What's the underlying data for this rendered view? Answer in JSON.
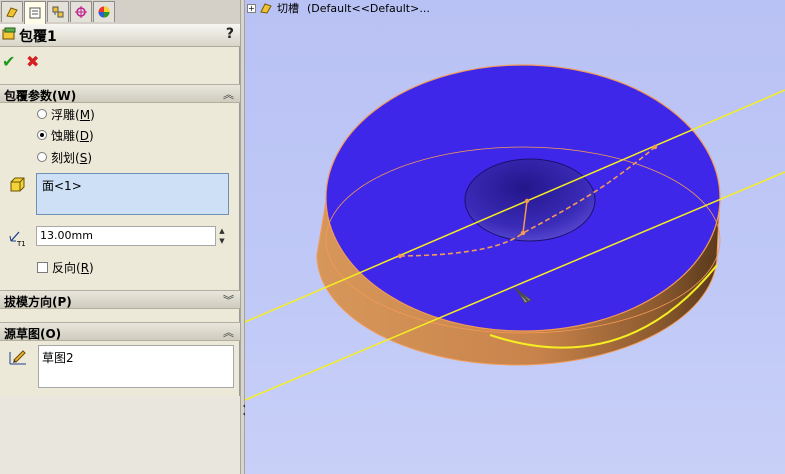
{
  "tabs": {
    "items": [
      {
        "icon": "feature-manager-icon"
      },
      {
        "icon": "property-manager-icon"
      },
      {
        "icon": "configuration-manager-icon"
      },
      {
        "icon": "dim-xpert-icon"
      },
      {
        "icon": "display-manager-icon"
      }
    ],
    "active": 1
  },
  "property_manager": {
    "title": "包覆1",
    "help": "?",
    "ok": "✔",
    "cancel": "✖"
  },
  "wrap_params": {
    "header": "包覆参数(W)",
    "options": [
      {
        "label": "浮雕",
        "mnemonic": "M",
        "selected": false
      },
      {
        "label": "蚀雕",
        "mnemonic": "D",
        "selected": true
      },
      {
        "label": "刻划",
        "mnemonic": "S",
        "selected": false
      }
    ],
    "face_selection": "面<1>",
    "depth_value": "13.00mm",
    "reverse": {
      "label": "反向",
      "mnemonic": "R",
      "checked": false
    }
  },
  "draft": {
    "header": "拔模方向(P)"
  },
  "source_sketch": {
    "header": "源草图(O)",
    "value": "草图2"
  },
  "feature_tree": {
    "item": "切槽",
    "config": "(Default<<Default>..."
  },
  "colors": {
    "top_face": "#3f27ea",
    "body": "#d98e52",
    "edge": "#f39a55",
    "construction_line": "#f5ee22",
    "viewport_bg": "#bcc5f5"
  }
}
